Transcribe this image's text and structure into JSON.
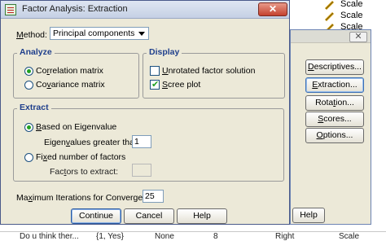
{
  "background": {
    "rows": [
      {
        "label": "Scale"
      },
      {
        "label": "Scale"
      },
      {
        "label": "Scale"
      }
    ],
    "bottom_row": {
      "col1": "Do u think ther...",
      "col2": "{1, Yes}",
      "col3": "None",
      "col4": "8",
      "col5": "Right",
      "col6": "Scale"
    }
  },
  "parent_dialog": {
    "close": "✕",
    "buttons": [
      {
        "label_u": "D",
        "label_rest": "escriptives..."
      },
      {
        "label_u": "E",
        "label_rest": "xtraction..."
      },
      {
        "label_pre": "Rota",
        "label_u": "t",
        "label_rest": "ion..."
      },
      {
        "label_u": "S",
        "label_rest": "cores..."
      },
      {
        "label_u": "O",
        "label_rest": "ptions..."
      }
    ],
    "help": "Help"
  },
  "dialog": {
    "title": "Factor Analysis: Extraction",
    "close": "✕",
    "method": {
      "label_u": "M",
      "label_rest": "ethod:",
      "value": "Principal components"
    },
    "analyze": {
      "title": "Analyze",
      "correlation": {
        "pre": "Co",
        "u": "r",
        "rest": "relation matrix",
        "selected": true
      },
      "covariance": {
        "pre": "Co",
        "u": "v",
        "rest": "ariance matrix",
        "selected": false
      }
    },
    "display": {
      "title": "Display",
      "unrotated": {
        "pre": "",
        "u": "U",
        "rest": "nrotated factor solution",
        "checked": false
      },
      "scree": {
        "pre": "",
        "u": "S",
        "rest": "cree plot",
        "checked": true
      }
    },
    "extract": {
      "title": "Extract",
      "eigen": {
        "pre": "",
        "u": "B",
        "rest": "ased on Eigenvalue",
        "selected": true
      },
      "eigen_greater": {
        "pre": "Eigen",
        "u": "v",
        "rest": "alues greater than:",
        "value": "1"
      },
      "fixed": {
        "pre": "Fi",
        "u": "x",
        "rest": "ed number of factors",
        "selected": false
      },
      "factors_to_extract": {
        "pre": "Fac",
        "u": "t",
        "rest": "ors to extract:",
        "value": ""
      }
    },
    "max_iter": {
      "pre": "Ma",
      "u": "x",
      "rest": "imum Iterations for Convergence:",
      "value": "25"
    },
    "buttons": {
      "continue": "Continue",
      "cancel": "Cancel",
      "help": "Help"
    }
  },
  "colors": {
    "group_title": "#1f3f8c",
    "dialog_bg": "#ece9d8",
    "radio_dot": "#21a121"
  }
}
